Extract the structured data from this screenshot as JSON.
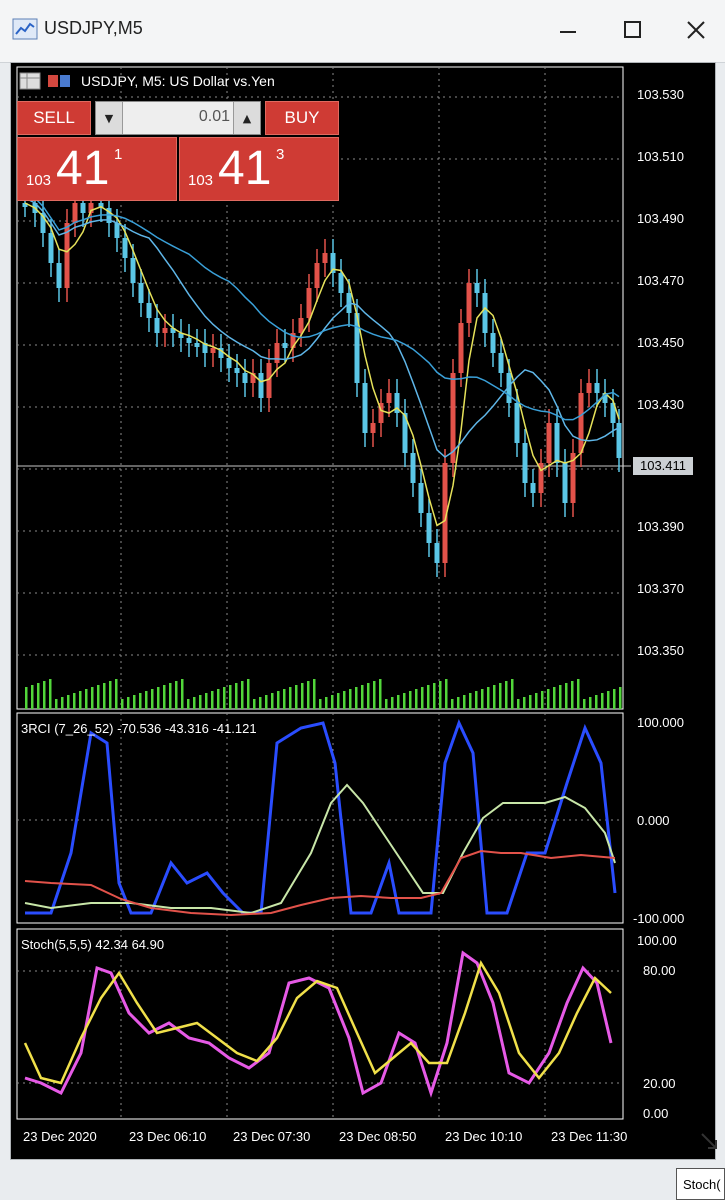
{
  "window": {
    "title": "USDJPY,M5",
    "controls": [
      "minimize-icon",
      "maximize-icon",
      "close-icon"
    ]
  },
  "chart": {
    "title": "USDJPY, M5:  US Dollar vs.Yen",
    "colors": {
      "bull": "#e2524a",
      "bear": "#5bc6e6",
      "ma_fast": "#e6e25a",
      "ma_mid": "#5fb6e8",
      "ma_slow": "#3aa0d8",
      "grid": "#8a8a8a",
      "volume": "#52d63a"
    },
    "price_axis": [
      "103.530",
      "103.510",
      "103.490",
      "103.470",
      "103.450",
      "103.430",
      "103.411",
      "103.390",
      "103.370",
      "103.350"
    ],
    "current_bid": "103.411"
  },
  "trade_panel": {
    "sell_label": "SELL",
    "buy_label": "BUY",
    "lot": "0.01",
    "sell_price": {
      "prefix": "103",
      "big": "41",
      "sup": "1"
    },
    "buy_price": {
      "prefix": "103",
      "big": "41",
      "sup": "3"
    }
  },
  "rci": {
    "label": "3RCI (7_26_52) -70.536 -43.316 -41.121",
    "axis": [
      "100.000",
      "0.000",
      "-100.000"
    ],
    "colors": {
      "short": "#2a4dff",
      "mid": "#c8e6a8",
      "long": "#e2524a"
    }
  },
  "stoch": {
    "label": "Stoch(5,5,5) 42.34 64.90",
    "axis": [
      "100.00",
      "80.00",
      "20.00",
      "0.00"
    ],
    "colors": {
      "main": "#e65ae6",
      "signal": "#f0e04a"
    }
  },
  "time_axis": [
    "23 Dec 2020",
    "23 Dec 06:10",
    "23 Dec 07:30",
    "23 Dec 08:50",
    "23 Dec 10:10",
    "23 Dec 11:30"
  ],
  "status": {
    "corner_tab": "Stoch("
  }
}
